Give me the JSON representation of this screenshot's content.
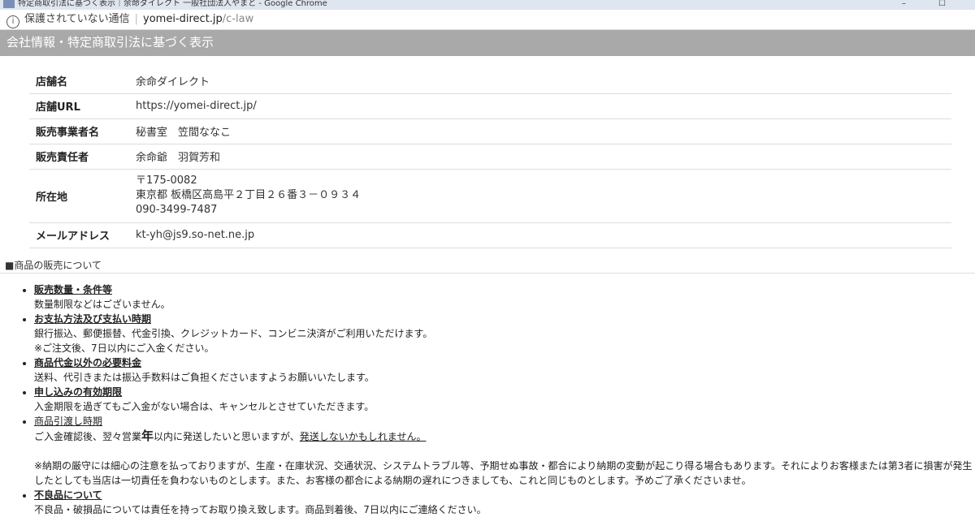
{
  "window": {
    "title": "特定商取引法に基づく表示｜余命ダイレクト 一般社団法人やまと - Google Chrome",
    "controls": [
      "–",
      "☐"
    ]
  },
  "addressbar": {
    "security_text": "保護されていない通信",
    "domain": "yomei-direct.jp",
    "path": "/c-law"
  },
  "header": {
    "title": "会社情報・特定商取引法に基づく表示"
  },
  "company": {
    "rows": [
      {
        "key": "店舗名",
        "value": [
          "余命ダイレクト"
        ]
      },
      {
        "key": "店舗URL",
        "value": [
          "https://yomei-direct.jp/"
        ]
      },
      {
        "key": "販売事業者名",
        "value": [
          "秘書室　笠間ななこ"
        ]
      },
      {
        "key": "販売責任者",
        "value": [
          "余命爺　羽賀芳和"
        ]
      },
      {
        "key": "所在地",
        "value": [
          "〒175-0082",
          "東京都 板橋区高島平２丁目２６番３－０９３４",
          "090-3499-7487"
        ]
      },
      {
        "key": "メールアドレス",
        "value": [
          "kt-yh@js9.so-net.ne.jp"
        ]
      }
    ]
  },
  "sales": {
    "section_title": "■商品の販売について",
    "items": [
      {
        "title": "販売数量・条件等",
        "lines": [
          "数量制限などはございません。"
        ]
      },
      {
        "title": "お支払方法及び支払い時期",
        "lines": [
          "銀行振込、郵便振替、代金引換、クレジットカード、コンビニ決済がご利用いただけます。",
          "※ご注文後、7日以内にご入金ください。"
        ]
      },
      {
        "title": "商品代金以外の必要料金",
        "lines": [
          "送料、代引きまたは振込手数料はご負担くださいますようお願いいたします。"
        ]
      },
      {
        "title": "申し込みの有効期限",
        "lines": [
          "入金期限を過ぎてもご入金がない場合は、キャンセルとさせていただきます。"
        ]
      },
      {
        "title": "商品引渡し時期",
        "line_a": "ご入金確認後、翌々営業",
        "line_b": "年",
        "line_c": "以内に発送したいと思いますが、",
        "line_d": "発送しないかもしれません。",
        "note1": "※納期の厳守には細心の注意を払っておりますが、生産・在庫状況、交通状況、システムトラブル等、予期せぬ事故・都合により納期の変動が起こり得る場合もあります。それによりお客様または第3者に損害が発生",
        "note2": "したとしても当店は一切責任を負わないものとします。また、お客様の都合による納期の遅れにつきましても、これと同じものとします。予めご了承くださいませ。"
      },
      {
        "title": "不良品について",
        "lines": [
          "不良品・破損品については責任を持ってお取り換え致します。商品到着後、7日以内にご連絡ください。"
        ]
      }
    ]
  }
}
